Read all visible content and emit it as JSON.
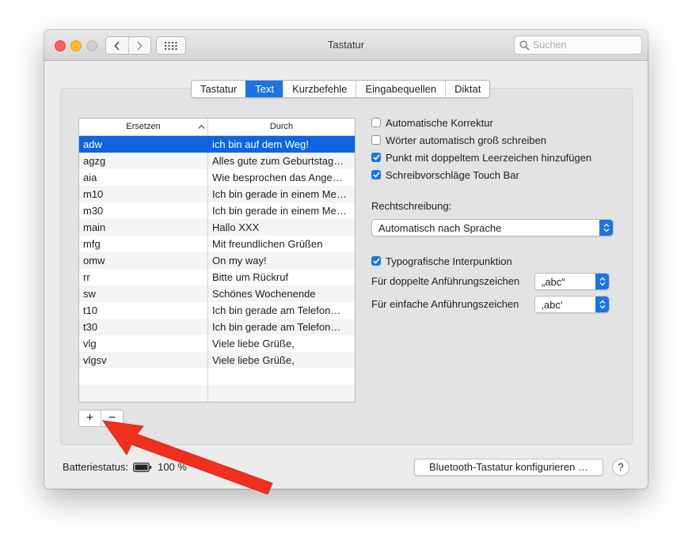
{
  "window": {
    "title": "Tastatur"
  },
  "toolbar": {
    "search_placeholder": "Suchen"
  },
  "tabs": [
    "Tastatur",
    "Text",
    "Kurzbefehle",
    "Eingabequellen",
    "Diktat"
  ],
  "active_tab": "Text",
  "table": {
    "col_replace": "Ersetzen",
    "col_with": "Durch",
    "rows": [
      {
        "replace": "adw",
        "with": "ich bin auf dem Weg!",
        "selected": true
      },
      {
        "replace": "agzg",
        "with": "Alles gute zum Geburtstag…"
      },
      {
        "replace": "aia",
        "with": "Wie besprochen das Ange…"
      },
      {
        "replace": "m10",
        "with": "Ich bin gerade in einem Me…"
      },
      {
        "replace": "m30",
        "with": "Ich bin gerade in einem Me…"
      },
      {
        "replace": "main",
        "with": "Hallo XXX"
      },
      {
        "replace": "mfg",
        "with": "Mit freundlichen Grüßen"
      },
      {
        "replace": "omw",
        "with": "On my way!"
      },
      {
        "replace": "rr",
        "with": "Bitte um Rückruf"
      },
      {
        "replace": "sw",
        "with": "Schönes Wochenende"
      },
      {
        "replace": "t10",
        "with": "Ich bin gerade am Telefon…"
      },
      {
        "replace": "t30",
        "with": "Ich bin gerade am Telefon…"
      },
      {
        "replace": "vlg",
        "with": "Viele liebe Grüße,"
      },
      {
        "replace": "vlgsv",
        "with": "Viele liebe Grüße,"
      }
    ],
    "add_label": "+",
    "remove_label": "−"
  },
  "options": {
    "autocorrect": {
      "label": "Automatische Korrektur",
      "checked": false
    },
    "capitalize": {
      "label": "Wörter automatisch groß schreiben",
      "checked": false
    },
    "period": {
      "label": "Punkt mit doppeltem Leerzeichen hinzufügen",
      "checked": true
    },
    "touchbar": {
      "label": "Schreibvorschläge Touch Bar",
      "checked": true
    }
  },
  "spelling": {
    "label": "Rechtschreibung:",
    "value": "Automatisch nach Sprache"
  },
  "typography": {
    "label": "Typografische Interpunktion",
    "checked": true,
    "double_label": "Für doppelte Anführungszeichen",
    "double_value": "„abc“",
    "single_label": "Für einfache Anführungszeichen",
    "single_value": "‚abc‘"
  },
  "footer": {
    "battery_label": "Batteriestatus:",
    "battery_value": "100 %",
    "bluetooth_button": "Bluetooth-Tastatur konfigurieren …",
    "help": "?"
  },
  "colors": {
    "accent": "#1a74e5",
    "selection": "#0e65dd",
    "arrow": "#f0301e"
  }
}
